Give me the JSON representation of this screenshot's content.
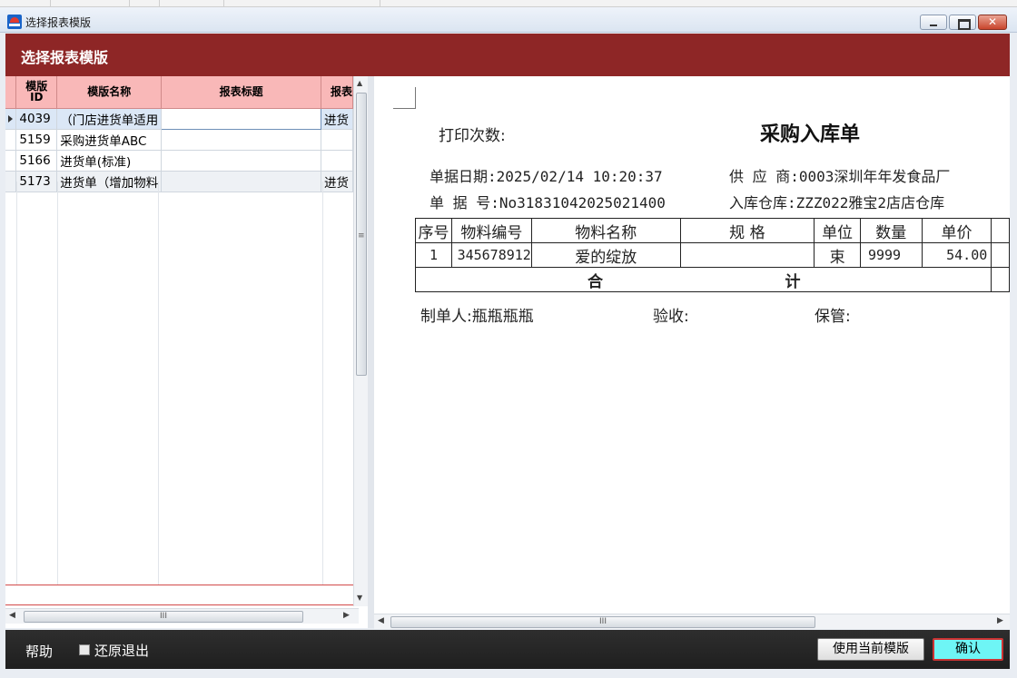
{
  "window": {
    "title": "选择报表模版",
    "controls": [
      "minimize",
      "maximize",
      "close"
    ]
  },
  "header": {
    "title": "选择报表模版"
  },
  "template_grid": {
    "columns": [
      "模版ID",
      "模版名称",
      "报表标题",
      "报表"
    ],
    "col_id_top": "模版",
    "col_id_bottom": "ID",
    "rows": [
      {
        "id": "4039",
        "name": "（门店进货单适用",
        "report_title": "",
        "report": "进货",
        "selected": true
      },
      {
        "id": "5159",
        "name": "采购进货单ABC",
        "report_title": "",
        "report": ""
      },
      {
        "id": "5166",
        "name": "进货单(标准)",
        "report_title": "",
        "report": ""
      },
      {
        "id": "5173",
        "name": "进货单（增加物料",
        "report_title": "",
        "report": "进货"
      }
    ]
  },
  "preview": {
    "print_count_label": "打印次数:",
    "doc_title": "采购入库单",
    "date_line": "单据日期:2025/02/14 10:20:37",
    "supplier_line": "供 应 商:0003深圳年年发食品厂",
    "docno_line": "单 据 号:No31831042025021400",
    "warehouse_line": "入库仓库:ZZZ022雅宝2店店仓库",
    "table_headers": [
      "序号",
      "物料编号",
      "物料名称",
      "规 格",
      "单位",
      "数量",
      "单价"
    ],
    "table_rows": [
      {
        "seq": "1",
        "code": "345678912",
        "name": "爱的绽放",
        "spec": "",
        "unit": "束",
        "qty": "9999",
        "price": "54.00"
      }
    ],
    "total_left": "合",
    "total_right": "计",
    "maker_line": "制单人:瓶瓶瓶瓶",
    "check_label": "验收:",
    "keeper_label": "保管:"
  },
  "footer": {
    "help_label": "帮助",
    "restore_exit_label": "还原退出",
    "restore_exit_checked": false,
    "use_template_label": "使用当前模版",
    "ok_label": "确认"
  },
  "colors": {
    "header_bg": "#8e2626",
    "grid_header_bg": "#f9b8b8",
    "ok_button_bg": "#6ef5f5"
  },
  "scrollbar_glyphs": {
    "up": "▲",
    "down": "▼",
    "left": "◀",
    "right": "▶",
    "grip_v": "≡",
    "grip_h": "III"
  }
}
